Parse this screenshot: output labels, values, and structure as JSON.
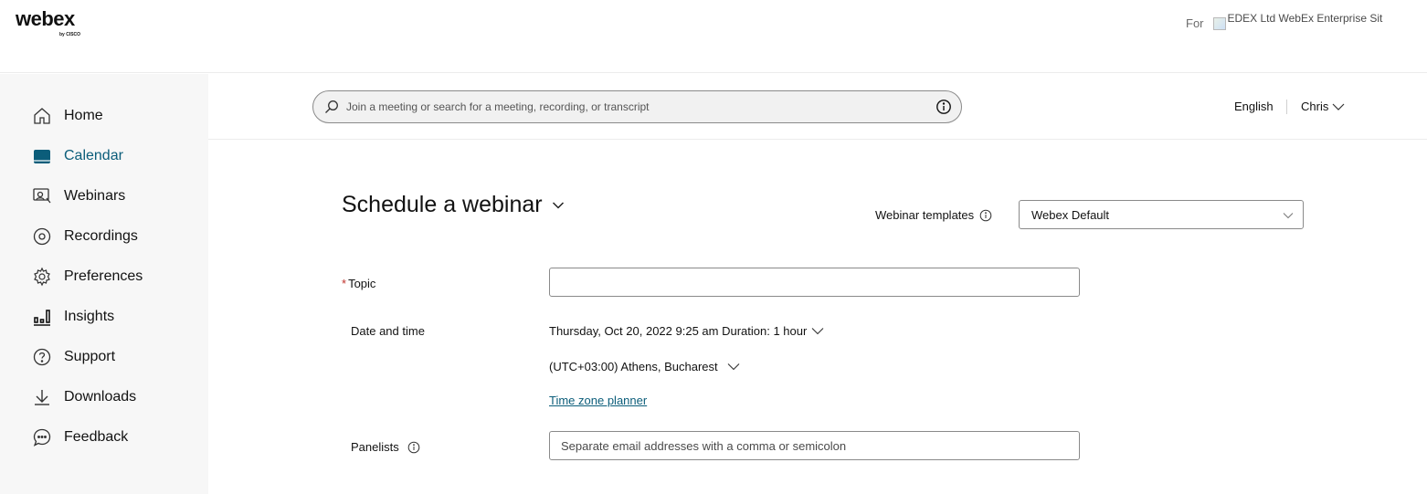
{
  "brand": {
    "name": "webex",
    "sub": "by CISCO"
  },
  "site": {
    "for_label": "For",
    "name": "EDEX Ltd WebEx Enterprise Sit"
  },
  "sidebar": {
    "items": [
      {
        "label": "Home",
        "icon": "home-icon"
      },
      {
        "label": "Calendar",
        "icon": "calendar-icon",
        "active": true
      },
      {
        "label": "Webinars",
        "icon": "webinar-icon"
      },
      {
        "label": "Recordings",
        "icon": "recording-icon"
      },
      {
        "label": "Preferences",
        "icon": "gear-icon"
      },
      {
        "label": "Insights",
        "icon": "insights-icon"
      },
      {
        "label": "Support",
        "icon": "help-icon"
      },
      {
        "label": "Downloads",
        "icon": "download-icon"
      },
      {
        "label": "Feedback",
        "icon": "feedback-icon"
      }
    ]
  },
  "header": {
    "search_placeholder": "Join a meeting or search for a meeting, recording, or transcript",
    "language": "English",
    "user": "Chris"
  },
  "form": {
    "title": "Schedule a webinar",
    "templates_label": "Webinar templates",
    "template_value": "Webex Default",
    "topic_required_mark": "*",
    "topic_label": "Topic",
    "topic_value": "",
    "datetime_label": "Date and time",
    "datetime_value": "Thursday, Oct 20, 2022 9:25 am Duration: 1 hour",
    "timezone_value": "(UTC+03:00) Athens, Bucharest",
    "timezone_planner_link": "Time zone planner",
    "panelists_label": "Panelists",
    "panelists_placeholder": "Separate email addresses with a comma or semicolon"
  },
  "colors": {
    "accent": "#0b5d7a",
    "required": "#c0312b",
    "sidebar_bg": "#f7f7f7"
  }
}
